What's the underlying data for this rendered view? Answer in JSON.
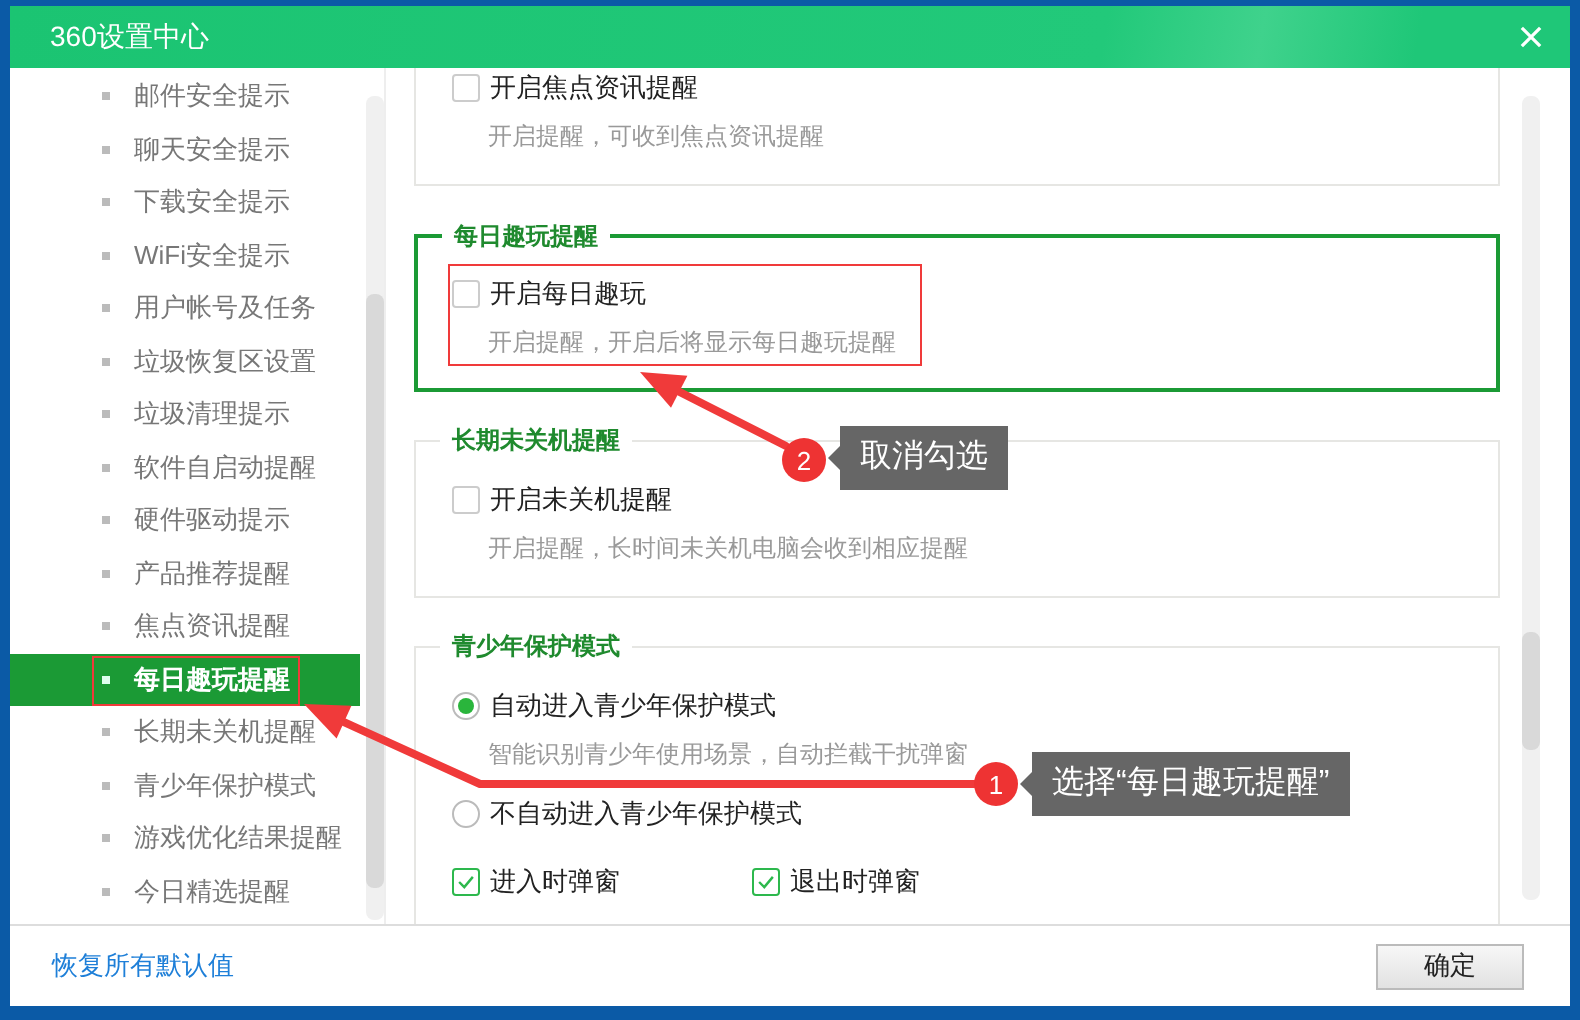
{
  "window": {
    "title": "360设置中心"
  },
  "sidebar": {
    "items": [
      {
        "label": "邮件安全提示",
        "selected": false,
        "annotated": false
      },
      {
        "label": "聊天安全提示",
        "selected": false,
        "annotated": false
      },
      {
        "label": "下载安全提示",
        "selected": false,
        "annotated": false
      },
      {
        "label": "WiFi安全提示",
        "selected": false,
        "annotated": false
      },
      {
        "label": "用户帐号及任务",
        "selected": false,
        "annotated": false
      },
      {
        "label": "垃圾恢复区设置",
        "selected": false,
        "annotated": false
      },
      {
        "label": "垃圾清理提示",
        "selected": false,
        "annotated": false
      },
      {
        "label": "软件自启动提醒",
        "selected": false,
        "annotated": false
      },
      {
        "label": "硬件驱动提示",
        "selected": false,
        "annotated": false
      },
      {
        "label": "产品推荐提醒",
        "selected": false,
        "annotated": false
      },
      {
        "label": "焦点资讯提醒",
        "selected": false,
        "annotated": false
      },
      {
        "label": "每日趣玩提醒",
        "selected": true,
        "annotated": true
      },
      {
        "label": "长期未关机提醒",
        "selected": false,
        "annotated": false
      },
      {
        "label": "青少年保护模式",
        "selected": false,
        "annotated": false
      },
      {
        "label": "游戏优化结果提醒",
        "selected": false,
        "annotated": false
      },
      {
        "label": "今日精选提醒",
        "selected": false,
        "annotated": false
      }
    ]
  },
  "groups": [
    {
      "highlighted": false,
      "options": [
        {
          "kind": "checkbox",
          "label": "开启焦点资讯提醒",
          "checked": false,
          "annotated": false,
          "description": "开启提醒，可收到焦点资讯提醒"
        }
      ]
    },
    {
      "title": "每日趣玩提醒",
      "highlighted": true,
      "options": [
        {
          "kind": "checkbox",
          "label": "开启每日趣玩",
          "checked": false,
          "annotated": true,
          "description": "开启提醒，开启后将显示每日趣玩提醒"
        }
      ]
    },
    {
      "title": "长期未关机提醒",
      "highlighted": false,
      "options": [
        {
          "kind": "checkbox",
          "label": "开启未关机提醒",
          "checked": false,
          "annotated": false,
          "description": "开启提醒，长时间未关机电脑会收到相应提醒"
        }
      ]
    },
    {
      "title": "青少年保护模式",
      "highlighted": false,
      "options": [
        {
          "kind": "radio",
          "label": "自动进入青少年保护模式",
          "selected": true,
          "annotated": false,
          "description": "智能识别青少年使用场景，自动拦截干扰弹窗"
        },
        {
          "kind": "radio",
          "label": "不自动进入青少年保护模式",
          "selected": false,
          "annotated": false
        }
      ],
      "toggles": [
        {
          "label": "进入时弹窗",
          "checked": true
        },
        {
          "label": "退出时弹窗",
          "checked": true
        }
      ]
    }
  ],
  "footer": {
    "restore_link": "恢复所有默认值",
    "ok_button": "确定"
  },
  "annotations": [
    {
      "number": "2",
      "text": "取消勾选"
    },
    {
      "number": "1",
      "text": "选择“每日趣玩提醒”"
    }
  ]
}
